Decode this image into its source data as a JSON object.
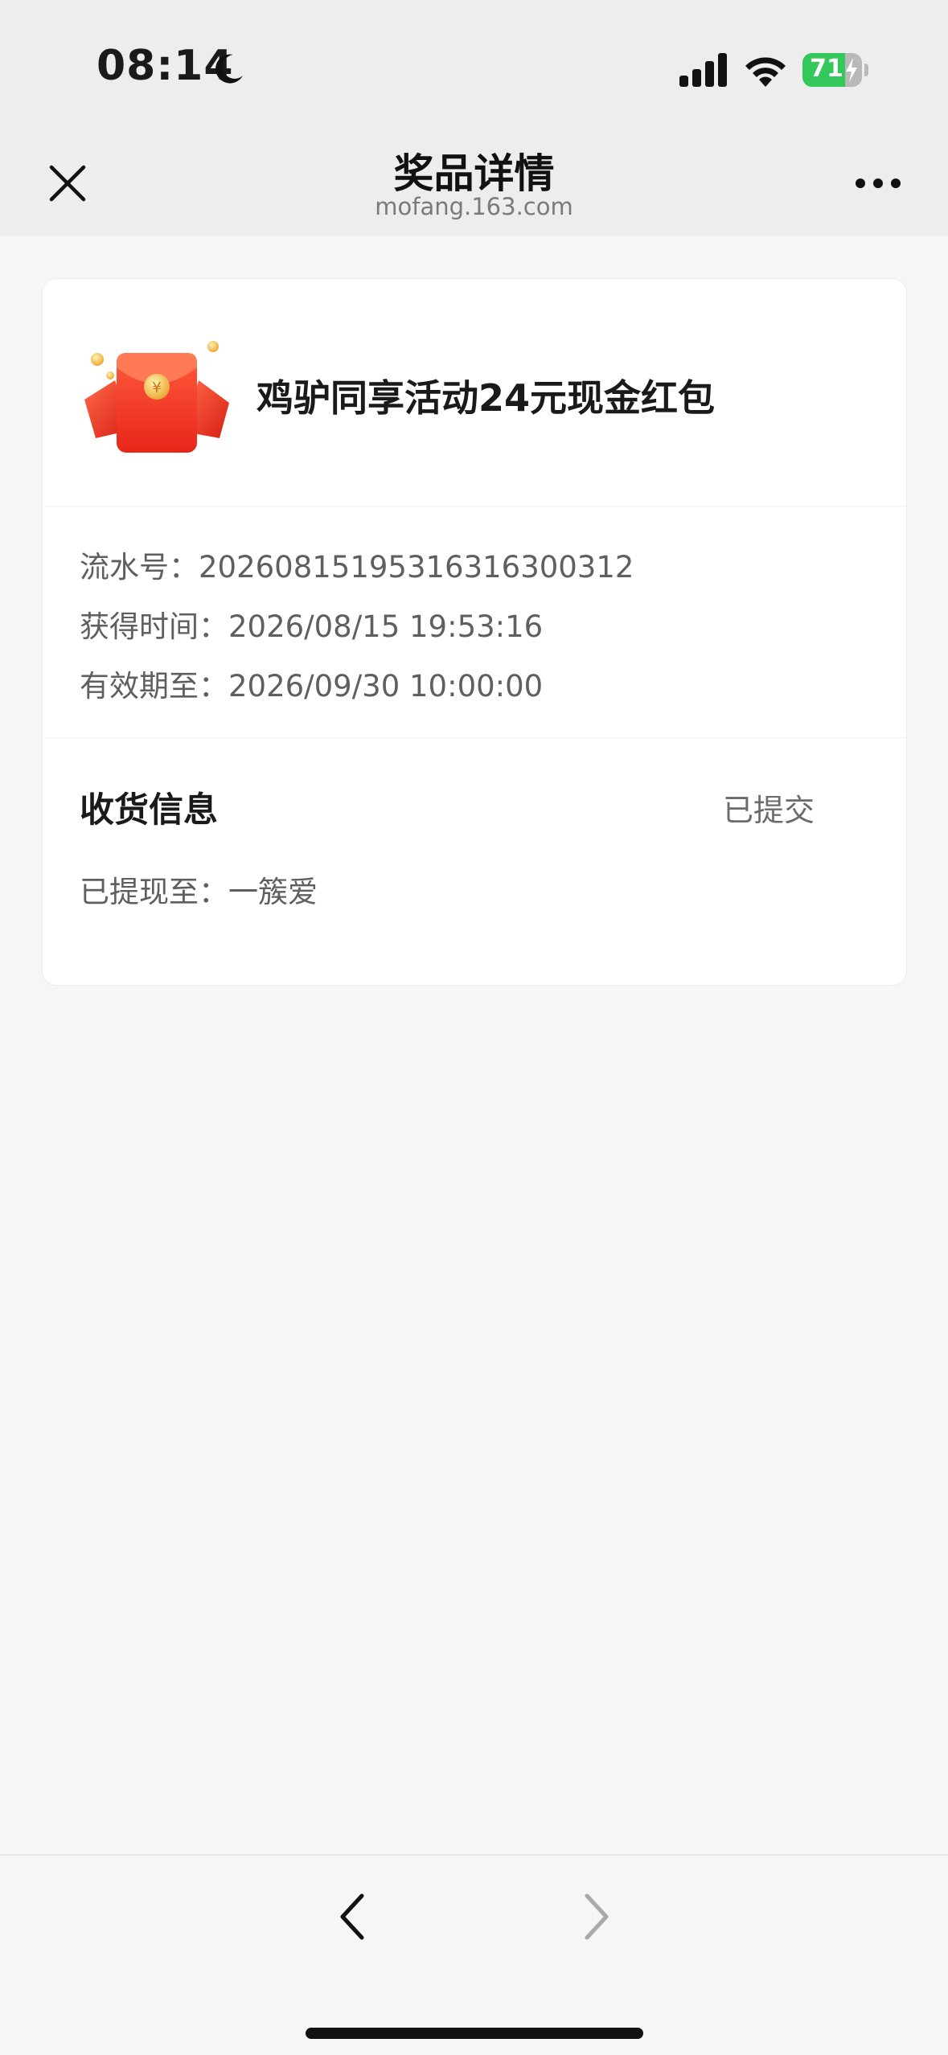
{
  "status_bar": {
    "time": "08:14",
    "battery_level": "71",
    "icons": [
      "moon-icon",
      "cellular-signal-icon",
      "wifi-icon",
      "battery-charging-icon"
    ],
    "colors": {
      "battery": "#34c759"
    }
  },
  "nav": {
    "title": "奖品详情",
    "domain": "mofang.163.com",
    "icons": [
      "close-icon",
      "more-icon"
    ]
  },
  "prize": {
    "icon": "red-envelope-icon",
    "name": "鸡驴同享活动24元现金红包"
  },
  "details": {
    "serial_label": "流水号：",
    "serial_value": "20260815195316316300312",
    "obtained_label": "获得时间：",
    "obtained_value": "2026/08/15 19:53:16",
    "valid_label": "有效期至：",
    "valid_value": "2026/09/30 10:00:00"
  },
  "shipping": {
    "title": "收货信息",
    "status": "已提交",
    "detail_label": "已提现至：",
    "detail_value": "一簇爱"
  },
  "bottom_bar": {
    "icons": [
      "back-chevron-icon",
      "forward-chevron-icon"
    ]
  }
}
